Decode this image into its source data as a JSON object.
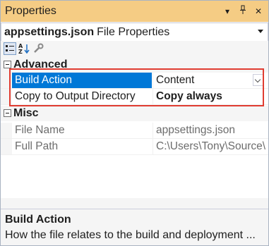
{
  "window": {
    "title": "Properties",
    "dropdown_glyph": "▾",
    "pin_glyph": "ᚮ",
    "close_glyph": "✕"
  },
  "selector": {
    "file_name": "appsettings.json",
    "type_text": "File Properties"
  },
  "toolbar": {
    "icons": [
      "categorized-icon",
      "alphabetical-icon",
      "property-pages-icon"
    ]
  },
  "grid": {
    "categories": [
      {
        "label": "Advanced",
        "rows": [
          {
            "key": "Build Action",
            "value": "Content"
          },
          {
            "key": "Copy to Output Directory",
            "value": "Copy always"
          }
        ]
      },
      {
        "label": "Misc",
        "rows": [
          {
            "key": "File Name",
            "value": "appsettings.json"
          },
          {
            "key": "Full Path",
            "value": "C:\\Users\\Tony\\Source\\"
          }
        ]
      }
    ]
  },
  "description": {
    "title": "Build Action",
    "text": "How the file relates to the build and deployment ..."
  },
  "colors": {
    "titlebar": "#f5cc84",
    "selection": "#0078d7",
    "highlight_box": "#e03c31"
  }
}
